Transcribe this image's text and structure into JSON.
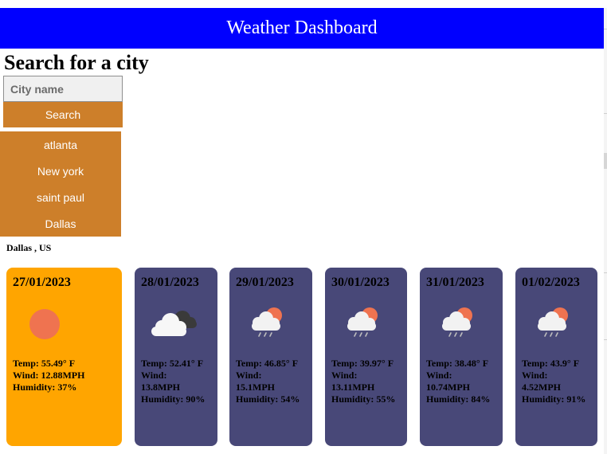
{
  "header": {
    "title": "Weather Dashboard"
  },
  "search": {
    "title": "Search for a city",
    "placeholder": "City name",
    "button_label": "Search"
  },
  "history": [
    "atlanta",
    "New york",
    "saint paul",
    "Dallas"
  ],
  "current_city": "Dallas , US",
  "colors": {
    "header_bg": "#0000ff",
    "accent": "#cd7f2a",
    "today_card": "#ffa500",
    "forecast_card": "#484878"
  },
  "today": {
    "date": "27/01/2023",
    "icon": "sun-icon",
    "temp": "Temp: 55.49° F",
    "wind": "Wind: 12.88MPH",
    "humidity": "Humidity: 37%"
  },
  "forecast": [
    {
      "date": "28/01/2023",
      "icon": "cloud-icon",
      "temp": "Temp: 52.41° F",
      "wind_label": "Wind:",
      "wind_value": "13.8MPH",
      "humidity": "Humidity: 90%"
    },
    {
      "date": "29/01/2023",
      "icon": "sun-cloud-rain-icon",
      "temp": "Temp: 46.85° F",
      "wind_label": "Wind:",
      "wind_value": "15.1MPH",
      "humidity": "Humidity: 54%"
    },
    {
      "date": "30/01/2023",
      "icon": "sun-cloud-rain-icon",
      "temp": "Temp: 39.97° F",
      "wind_label": "Wind:",
      "wind_value": "13.11MPH",
      "humidity": "Humidity: 55%"
    },
    {
      "date": "31/01/2023",
      "icon": "sun-cloud-rain-icon",
      "temp": "Temp: 38.48° F",
      "wind_label": "Wind:",
      "wind_value": "10.74MPH",
      "humidity": "Humidity: 84%"
    },
    {
      "date": "01/02/2023",
      "icon": "sun-cloud-rain-icon",
      "temp": "Temp: 43.9° F",
      "wind_label": "Wind:",
      "wind_value": "4.52MPH",
      "humidity": "Humidity: 91%"
    }
  ]
}
